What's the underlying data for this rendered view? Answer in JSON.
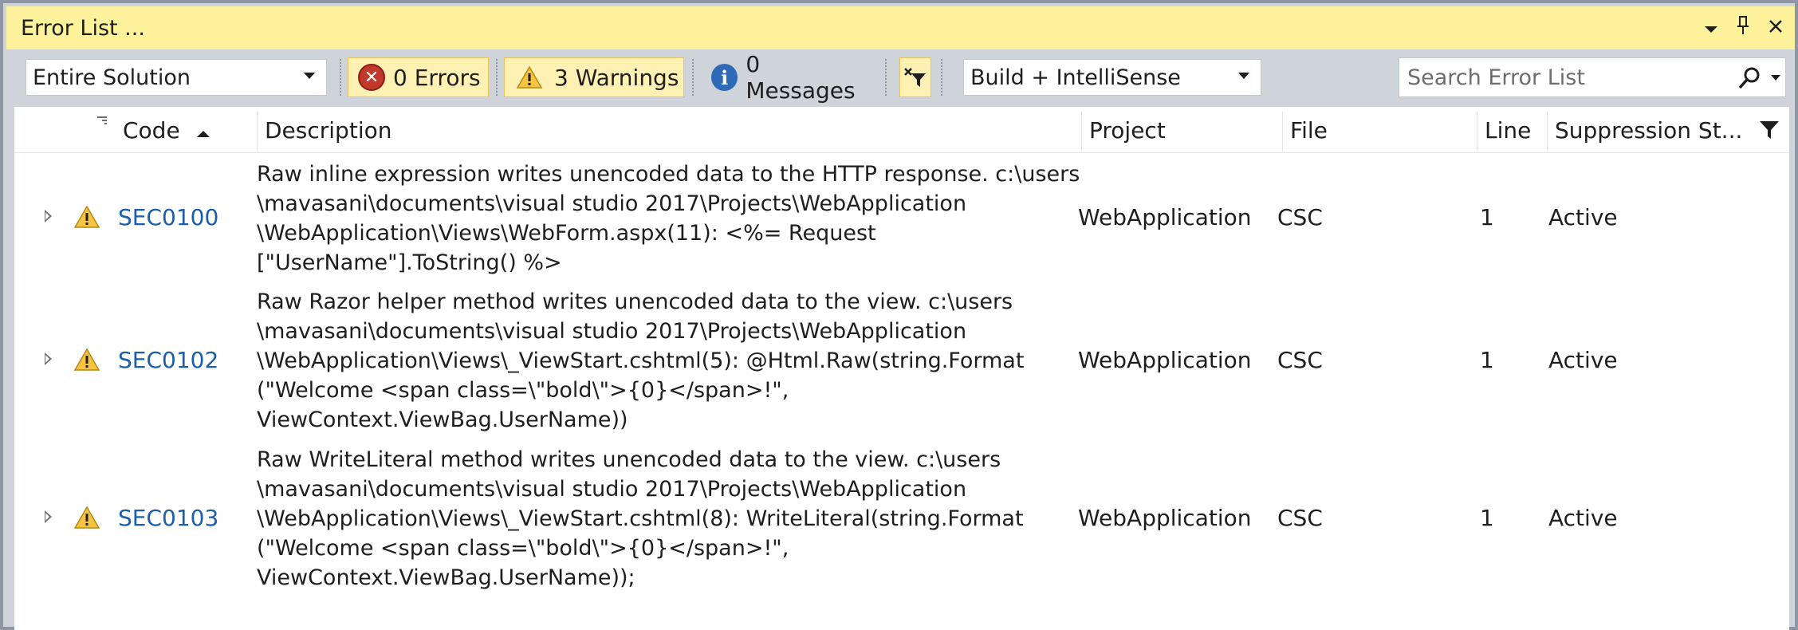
{
  "window": {
    "title": "Error List ...",
    "icons": [
      "dropdown-arrow-icon",
      "pin-icon",
      "close-icon"
    ]
  },
  "toolbar": {
    "scope_value": "Entire Solution",
    "errors_label": "0 Errors",
    "warnings_label": "3 Warnings",
    "messages_label": "0 Messages",
    "source_value": "Build + IntelliSense",
    "search_placeholder": "Search Error List"
  },
  "columns": {
    "code": "Code",
    "description": "Description",
    "project": "Project",
    "file": "File",
    "line": "Line",
    "suppression": "Suppression St..."
  },
  "rows": [
    {
      "code": "SEC0100",
      "description": "Raw inline expression writes unencoded data to the HTTP response. c:\\users\n\\mavasani\\documents\\visual studio 2017\\Projects\\WebApplication\n\\WebApplication\\Views\\WebForm.aspx(11): <%= Request\n[\"UserName\"].ToString() %>",
      "project": "WebApplication",
      "file": "CSC",
      "line": "1",
      "suppression": "Active"
    },
    {
      "code": "SEC0102",
      "description": "Raw Razor helper method writes unencoded data to the view. c:\\users\n\\mavasani\\documents\\visual studio 2017\\Projects\\WebApplication\n\\WebApplication\\Views\\_ViewStart.cshtml(5): @Html.Raw(string.Format\n(\"Welcome <span class=\\\"bold\\\">{0}</span>!\",\nViewContext.ViewBag.UserName))",
      "project": "WebApplication",
      "file": "CSC",
      "line": "1",
      "suppression": "Active"
    },
    {
      "code": "SEC0103",
      "description": "Raw WriteLiteral method writes unencoded data to the view. c:\\users\n\\mavasani\\documents\\visual studio 2017\\Projects\\WebApplication\n\\WebApplication\\Views\\_ViewStart.cshtml(8): WriteLiteral(string.Format\n(\"Welcome <span class=\\\"bold\\\">{0}</span>!\",\nViewContext.ViewBag.UserName));",
      "project": "WebApplication",
      "file": "CSC",
      "line": "1",
      "suppression": "Active"
    }
  ],
  "colors": {
    "title_bar": "#fff29d",
    "chrome": "#cfd4db",
    "code_link": "#1b5eab",
    "pressed_button": "#fff0b3"
  }
}
